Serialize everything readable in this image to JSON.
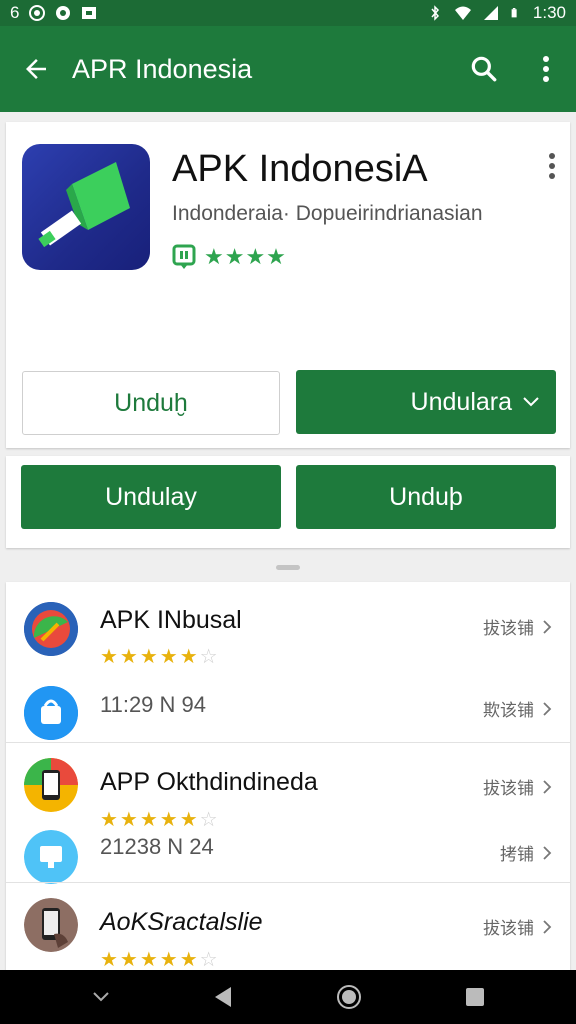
{
  "status": {
    "time": "1:30",
    "left_icons": [
      "notification-icon",
      "app-icon",
      "sync-icon",
      "media-icon"
    ],
    "right_icons": [
      "bluetooth-icon",
      "wifi-icon",
      "signal-icon",
      "battery-icon"
    ]
  },
  "appbar": {
    "title": "APR Indonesia",
    "icons": [
      "back-arrow-icon",
      "search-icon",
      "more-vert-icon"
    ]
  },
  "app": {
    "name": "APK IndonesiA",
    "subtitle": "Indonderaia· Dopueirindrianasian",
    "rating_stars": 4,
    "rating_badge_icon": "editors-choice-icon"
  },
  "buttons": {
    "primary_outline": "Unduḫ",
    "primary_fill": "Undulara",
    "secondary_left": "Undulay",
    "secondary_right": "Unduþ"
  },
  "list": [
    {
      "title": "APK INbusal",
      "rating": 4.5,
      "action": "拔该铺",
      "number": "11:29 N 94",
      "number_action": "欺该铺"
    },
    {
      "title": "APP Okthdindineda",
      "rating": 4.5,
      "action": "拔该铺",
      "number": "21238 N 24",
      "number_action": "拷铺"
    },
    {
      "title": "AoKSractalslie",
      "rating": 4.5,
      "action": "拔该铺"
    }
  ],
  "colors": {
    "primary": "#1e7a3c",
    "statusbar": "#1c6b35",
    "star_green": "#2ea44f",
    "star_gold": "#e8b20e"
  }
}
